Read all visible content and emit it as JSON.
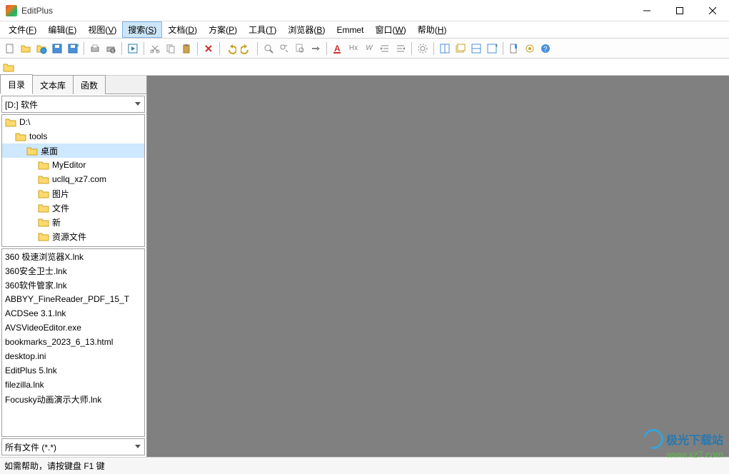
{
  "title": "EditPlus",
  "menus": [
    {
      "label": "文件",
      "accel": "F"
    },
    {
      "label": "编辑",
      "accel": "E"
    },
    {
      "label": "视图",
      "accel": "V"
    },
    {
      "label": "搜索",
      "accel": "S",
      "hot": true
    },
    {
      "label": "文档",
      "accel": "D"
    },
    {
      "label": "方案",
      "accel": "P"
    },
    {
      "label": "工具",
      "accel": "T"
    },
    {
      "label": "浏览器",
      "accel": "B"
    },
    {
      "label": "Emmet",
      "accel": ""
    },
    {
      "label": "窗口",
      "accel": "W"
    },
    {
      "label": "帮助",
      "accel": "H"
    }
  ],
  "path_value": "",
  "sidebar": {
    "tabs": [
      "目录",
      "文本库",
      "函数"
    ],
    "active_tab": 0,
    "drive": "[D:] 软件",
    "tree": [
      {
        "label": "D:\\",
        "indent": 0,
        "selected": false
      },
      {
        "label": "tools",
        "indent": 1,
        "selected": false
      },
      {
        "label": "桌面",
        "indent": 2,
        "selected": true
      },
      {
        "label": "MyEditor",
        "indent": 3,
        "selected": false
      },
      {
        "label": "ucllq_xz7.com",
        "indent": 3,
        "selected": false
      },
      {
        "label": "图片",
        "indent": 3,
        "selected": false
      },
      {
        "label": "文件",
        "indent": 3,
        "selected": false
      },
      {
        "label": "新",
        "indent": 3,
        "selected": false
      },
      {
        "label": "资源文件",
        "indent": 3,
        "selected": false
      }
    ],
    "files": [
      "360 极速浏览器X.lnk",
      "360安全卫士.lnk",
      "360软件管家.lnk",
      "ABBYY_FineReader_PDF_15_T",
      "ACDSee 3.1.lnk",
      "AVSVideoEditor.exe",
      "bookmarks_2023_6_13.html",
      "desktop.ini",
      "EditPlus 5.lnk",
      "filezilla.lnk",
      "Focusky动画演示大师.lnk"
    ],
    "filter": "所有文件 (*.*)"
  },
  "status": "如需帮助，请按键盘 F1 键",
  "watermark": {
    "name": "极光下载站",
    "url": "www.xz7.com"
  }
}
